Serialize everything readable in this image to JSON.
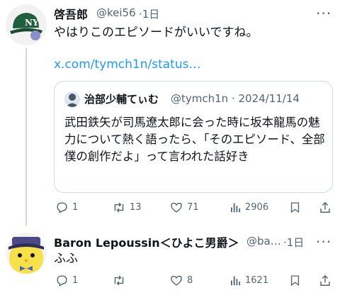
{
  "tweet1": {
    "name": "啓吾郎",
    "handle": "@kei56",
    "time": "·1日",
    "text": "やはりこのエピソードがいいですね。",
    "link": "x.com/tymch1n/status…"
  },
  "quote": {
    "name": "治部少輔てぃむ",
    "handle_date": "@tymch1n · 2024/11/14",
    "text": "武田鉄矢が司馬遼太郎に会った時に坂本龍馬の魅力について熱く語ったら、「そのエピソード、全部僕の創作だよ」って言われた話好き"
  },
  "tweet1_actions": {
    "replies": "1",
    "reposts": "13",
    "likes": "71",
    "views": "2906"
  },
  "tweet2": {
    "name": "Baron Lepoussin＜ひよこ男爵＞",
    "handle": "@ba…",
    "time": "·1日",
    "text": "ふふ"
  },
  "tweet2_actions": {
    "replies": "1",
    "reposts": "",
    "likes": "8",
    "views": "1621"
  },
  "icons": [
    "more-icon",
    "reply-icon",
    "repost-icon",
    "like-icon",
    "views-icon",
    "bookmark-icon",
    "share-icon"
  ]
}
